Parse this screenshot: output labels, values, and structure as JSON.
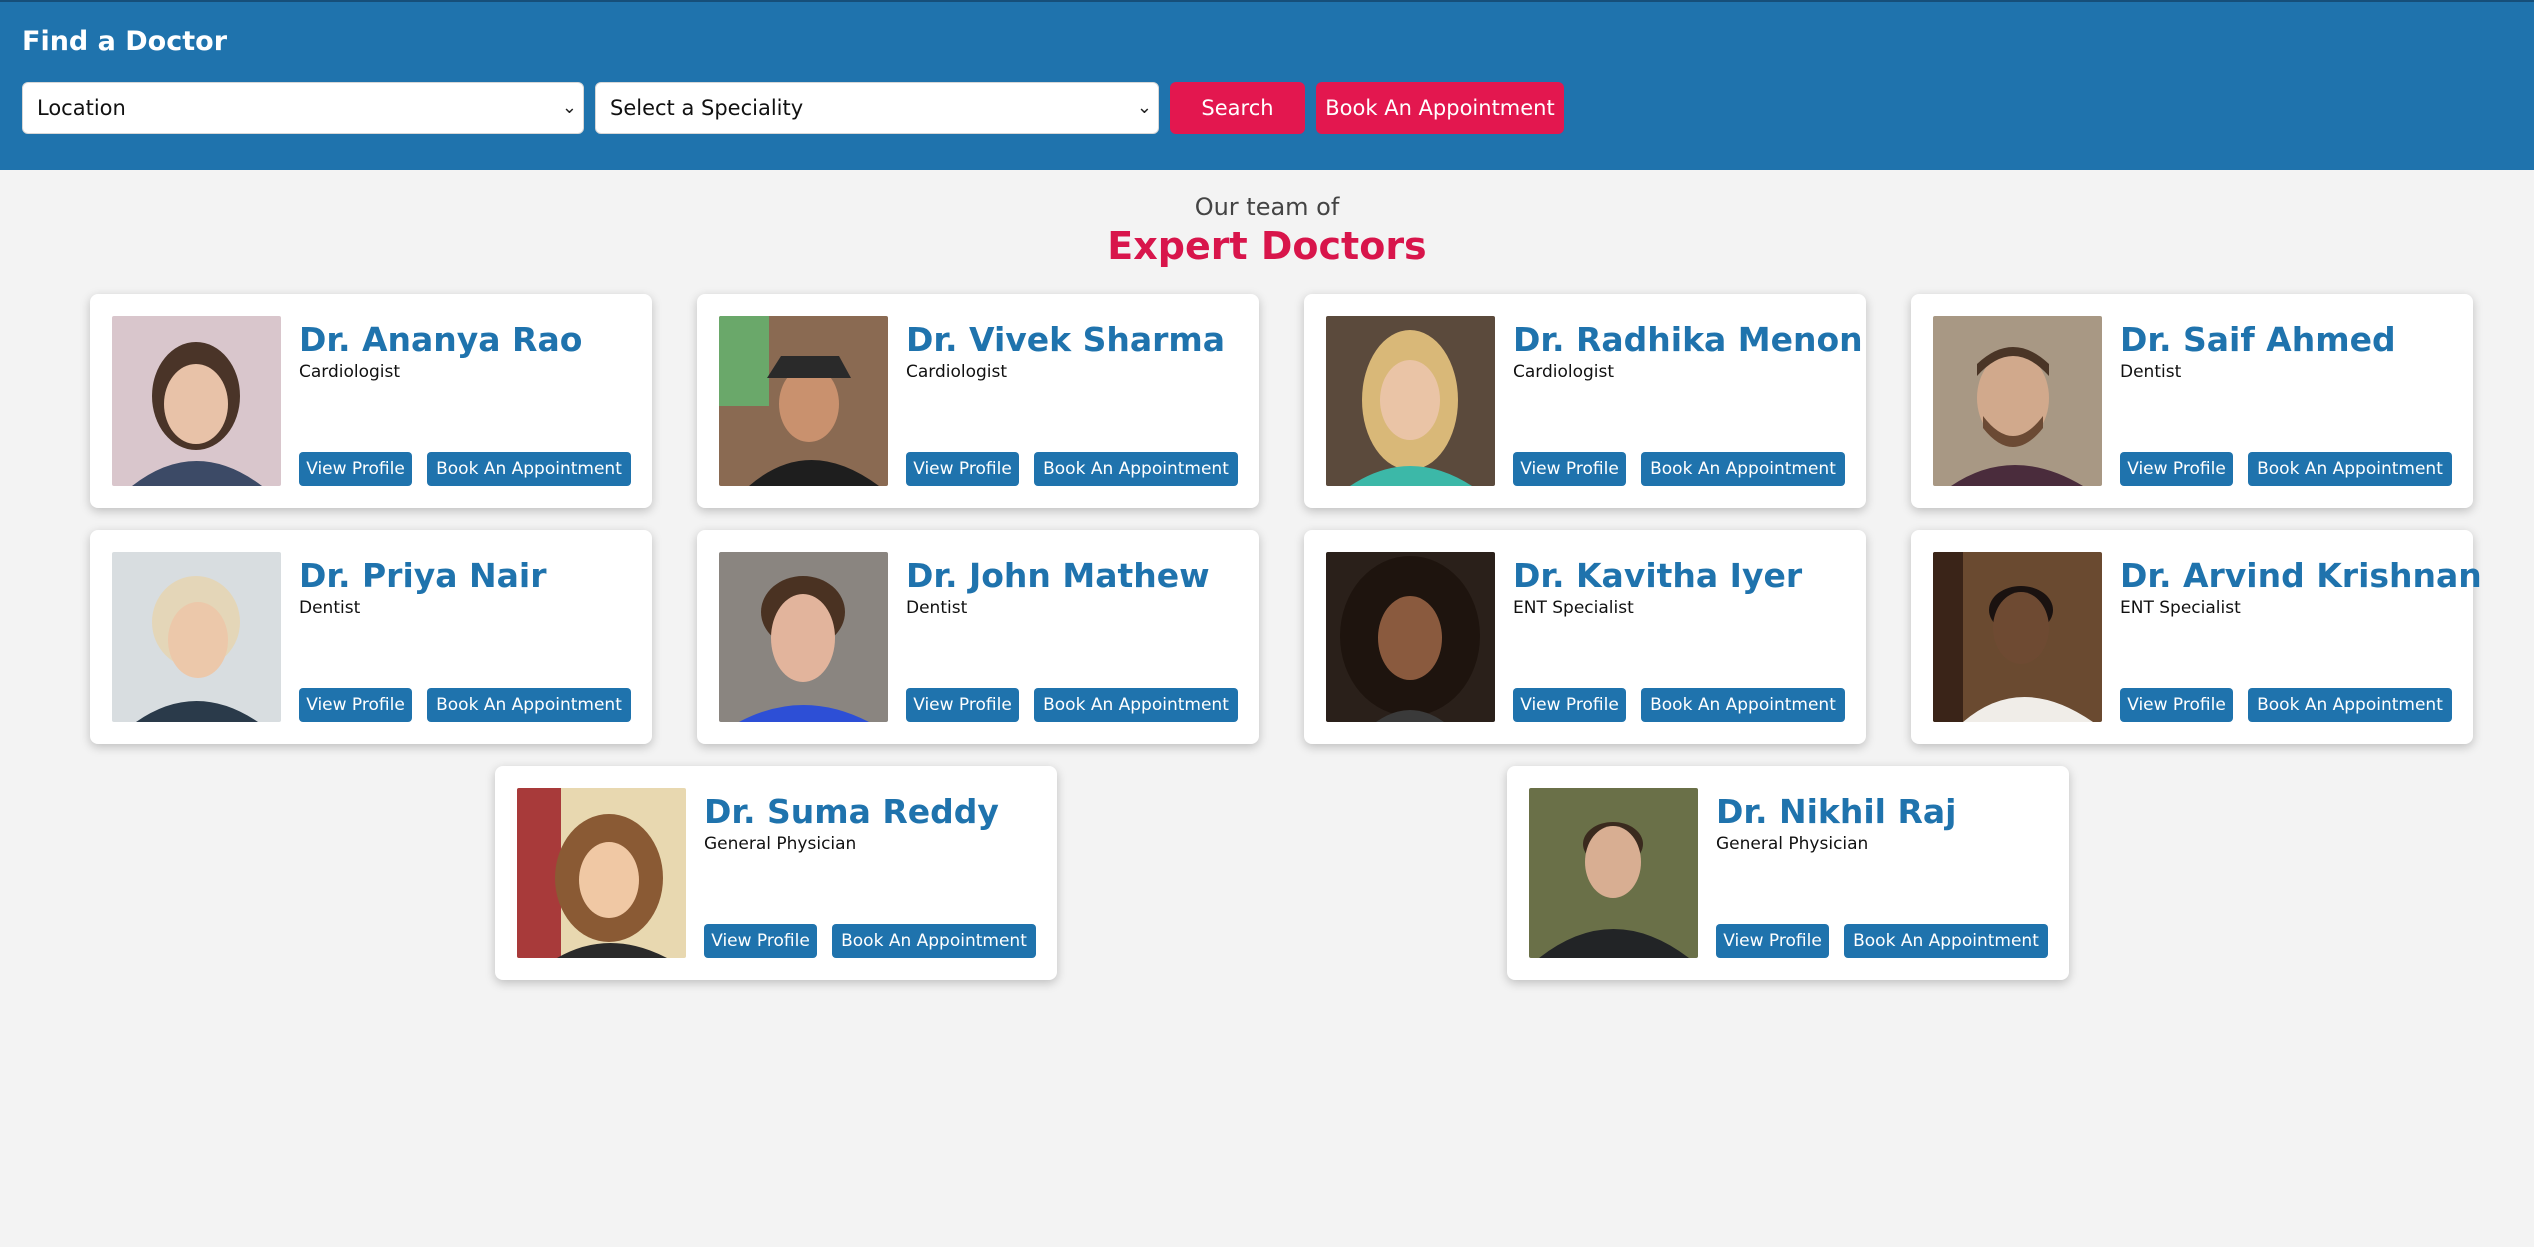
{
  "header": {
    "title": "Find a Doctor",
    "location_select": "Location",
    "specialty_select": "Select a Speciality",
    "search_label": "Search",
    "book_label": "Book An Appointment"
  },
  "section": {
    "subtitle": "Our team of",
    "title": "Expert Doctors"
  },
  "colors": {
    "primary": "#1f73ad",
    "accent": "#e3174f",
    "background": "#f3f3f3"
  },
  "doctors": [
    {
      "name": "Dr. Ananya Rao",
      "specialty": "Cardiologist",
      "view_label": "View Profile",
      "book_label": "Book An Appointment"
    },
    {
      "name": "Dr. Vivek Sharma",
      "specialty": "Cardiologist",
      "view_label": "View Profile",
      "book_label": "Book An Appointment"
    },
    {
      "name": "Dr. Radhika Menon",
      "specialty": "Cardiologist",
      "view_label": "View Profile",
      "book_label": "Book An Appointment"
    },
    {
      "name": "Dr. Saif Ahmed",
      "specialty": "Dentist",
      "view_label": "View Profile",
      "book_label": "Book An Appointment"
    },
    {
      "name": "Dr. Priya Nair",
      "specialty": "Dentist",
      "view_label": "View Profile",
      "book_label": "Book An Appointment"
    },
    {
      "name": "Dr. John Mathew",
      "specialty": "Dentist",
      "view_label": "View Profile",
      "book_label": "Book An Appointment"
    },
    {
      "name": "Dr. Kavitha Iyer",
      "specialty": "ENT Specialist",
      "view_label": "View Profile",
      "book_label": "Book An Appointment"
    },
    {
      "name": "Dr. Arvind Krishnan",
      "specialty": "ENT Specialist",
      "view_label": "View Profile",
      "book_label": "Book An Appointment"
    },
    {
      "name": "Dr. Suma Reddy",
      "specialty": "General Physician",
      "view_label": "View Profile",
      "book_label": "Book An Appointment"
    },
    {
      "name": "Dr. Nikhil Raj",
      "specialty": "General Physician",
      "view_label": "View Profile",
      "book_label": "Book An Appointment"
    }
  ]
}
